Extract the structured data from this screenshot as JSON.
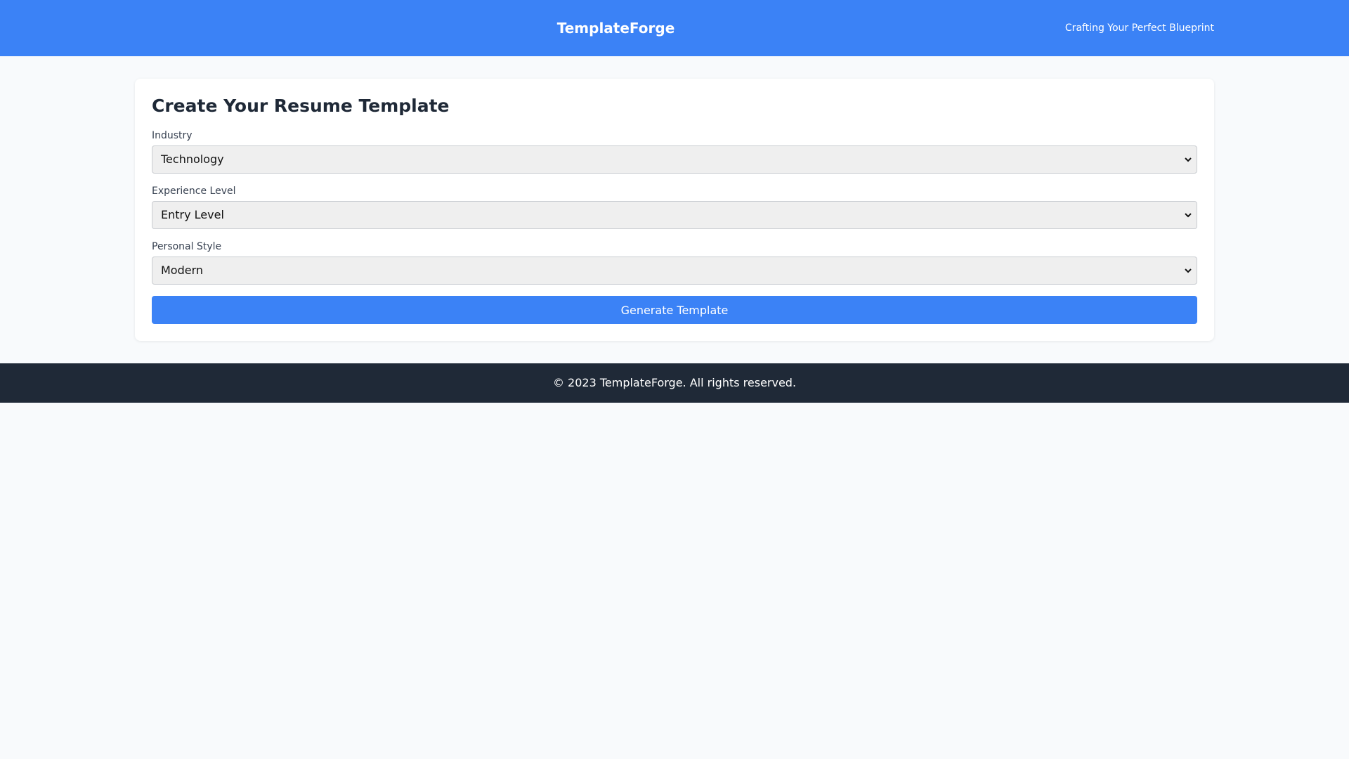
{
  "header": {
    "title": "TemplateForge",
    "tagline": "Crafting Your Perfect Blueprint"
  },
  "form": {
    "title": "Create Your Resume Template",
    "fields": [
      {
        "label": "Industry",
        "selected": "Technology"
      },
      {
        "label": "Experience Level",
        "selected": "Entry Level"
      },
      {
        "label": "Personal Style",
        "selected": "Modern"
      }
    ],
    "submit_label": "Generate Template"
  },
  "footer": {
    "text": "© 2023 TemplateForge. All rights reserved."
  },
  "icons": {
    "select_arrow": "chevron-down-icon"
  },
  "colors": {
    "primary": "#3b82f6",
    "footer_bg": "#1f2937",
    "page_bg": "#f8fafc"
  }
}
